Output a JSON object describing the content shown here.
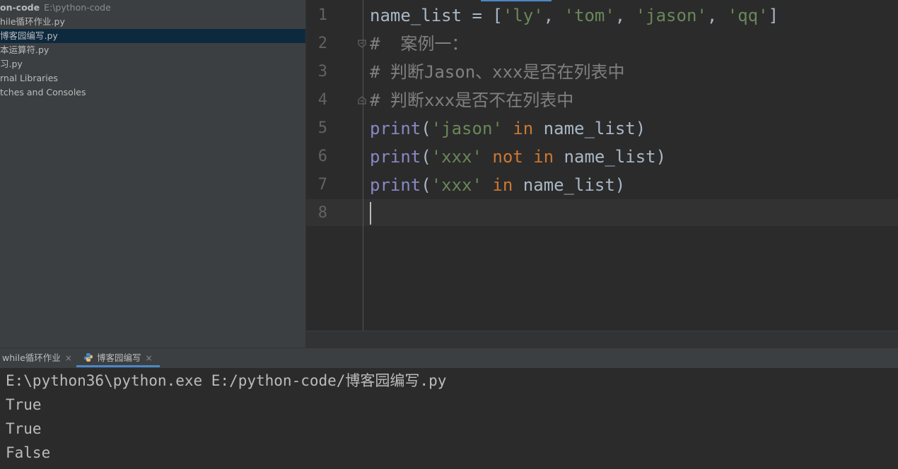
{
  "project": {
    "root_name": "on-code",
    "root_path": "E:\\python-code",
    "items": [
      {
        "label": "hile循环作业.py"
      },
      {
        "label": "博客园编写.py"
      },
      {
        "label": "本运算符.py"
      },
      {
        "label": "习.py"
      },
      {
        "label": "rnal Libraries"
      },
      {
        "label": "tches and Consoles"
      }
    ]
  },
  "editor": {
    "line_numbers": [
      "1",
      "2",
      "3",
      "4",
      "5",
      "6",
      "7",
      "8"
    ],
    "lines": [
      [
        {
          "t": "name_list = [",
          "c": "plain"
        },
        {
          "t": "'ly'",
          "c": "str"
        },
        {
          "t": ", ",
          "c": "plain"
        },
        {
          "t": "'tom'",
          "c": "str"
        },
        {
          "t": ", ",
          "c": "plain"
        },
        {
          "t": "'jason'",
          "c": "str"
        },
        {
          "t": ", ",
          "c": "plain"
        },
        {
          "t": "'qq'",
          "c": "str"
        },
        {
          "t": "]",
          "c": "plain"
        }
      ],
      [
        {
          "t": "#  案例一：",
          "c": "cmt"
        }
      ],
      [
        {
          "t": "# 判断Jason、xxx是否在列表中",
          "c": "cmt"
        }
      ],
      [
        {
          "t": "# 判断xxx是否不在列表中",
          "c": "cmt"
        }
      ],
      [
        {
          "t": "print",
          "c": "fn"
        },
        {
          "t": "(",
          "c": "plain"
        },
        {
          "t": "'jason'",
          "c": "str"
        },
        {
          "t": " ",
          "c": "plain"
        },
        {
          "t": "in",
          "c": "kw"
        },
        {
          "t": " name_list)",
          "c": "plain"
        }
      ],
      [
        {
          "t": "print",
          "c": "fn"
        },
        {
          "t": "(",
          "c": "plain"
        },
        {
          "t": "'xxx'",
          "c": "str"
        },
        {
          "t": " ",
          "c": "plain"
        },
        {
          "t": "not in",
          "c": "kw"
        },
        {
          "t": " name_list)",
          "c": "plain"
        }
      ],
      [
        {
          "t": "print",
          "c": "fn"
        },
        {
          "t": "(",
          "c": "plain"
        },
        {
          "t": "'xxx'",
          "c": "str"
        },
        {
          "t": " ",
          "c": "plain"
        },
        {
          "t": "in",
          "c": "kw"
        },
        {
          "t": " name_list)",
          "c": "plain"
        }
      ],
      []
    ]
  },
  "run_tabs": [
    {
      "label": "while循环作业",
      "close": "×"
    },
    {
      "label": "博客园编写",
      "close": "×",
      "icon": "python-icon"
    }
  ],
  "console": {
    "lines": [
      "E:\\python36\\python.exe E:/python-code/博客园编写.py",
      "True",
      "True",
      "False"
    ]
  },
  "colors": {
    "keyword": "#cc7832",
    "string": "#6a8759",
    "builtin": "#8888c6",
    "comment": "#808080",
    "selection": "#0d293e",
    "accent": "#4a88c7"
  }
}
